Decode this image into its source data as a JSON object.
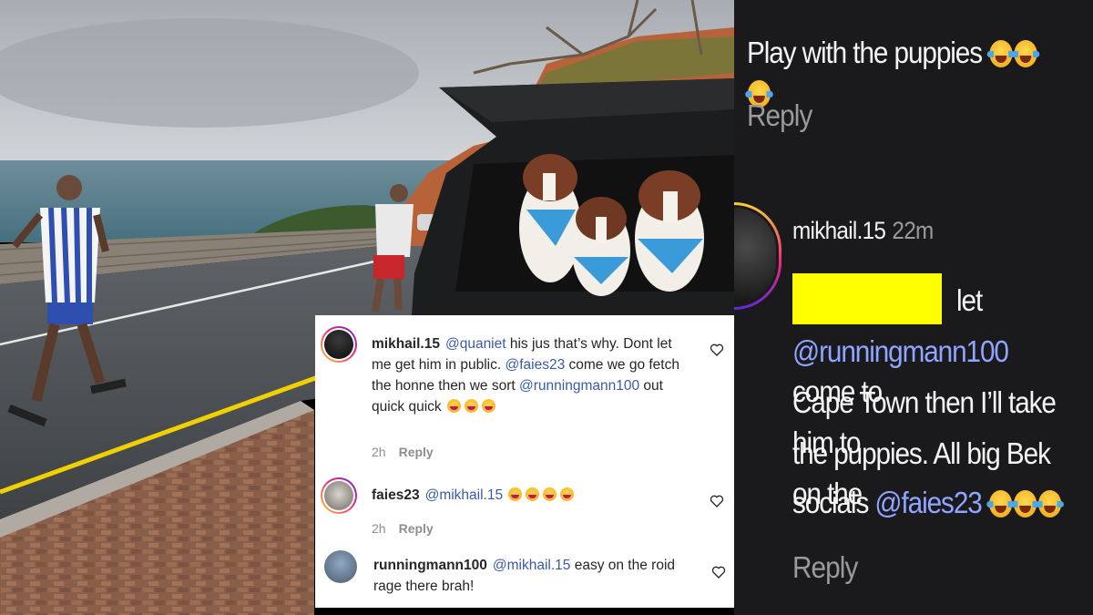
{
  "colors": {
    "mention_light": "#3a5ba8",
    "mention_dark": "#8fa5ff",
    "highlight_redaction": "#ffff00",
    "dark_panel_bg": "#1a1a1c"
  },
  "light_thread": {
    "comments": [
      {
        "username": "mikhail.15",
        "segments": [
          {
            "text": "@quaniet",
            "mention": true
          },
          {
            "text": " his jus that’s why. Dont let me get him in public. ",
            "mention": false
          },
          {
            "text": "@faies23",
            "mention": true
          },
          {
            "text": " come we go fetch the honne then we sort ",
            "mention": false
          },
          {
            "text": "@runningmann100",
            "mention": true
          },
          {
            "text": " out quick quick ",
            "mention": false
          }
        ],
        "emoji_count": 3,
        "time": "2h",
        "reply_label": "Reply",
        "avatar_ring": true
      },
      {
        "username": "faies23",
        "segments": [
          {
            "text": "@mikhail.15",
            "mention": true
          },
          {
            "text": " ",
            "mention": false
          }
        ],
        "emoji_count": 4,
        "time": "2h",
        "reply_label": "Reply",
        "avatar_ring": true
      },
      {
        "username": "runningmann100",
        "segments": [
          {
            "text": "@mikhail.15",
            "mention": true
          },
          {
            "text": " easy on the roid rage there brah!",
            "mention": false
          }
        ],
        "emoji_count": 0,
        "avatar_ring": false
      }
    ],
    "like_icon": "heart-outline-icon"
  },
  "dark_thread": {
    "top_comment_text": "Play with the puppies",
    "top_emoji_count": 3,
    "top_reply_label": "Reply",
    "comment": {
      "username": "mikhail.15",
      "time": "22m",
      "lines": [
        {
          "segments": [
            {
              "text": "let",
              "mention": false
            }
          ]
        },
        {
          "segments": [
            {
              "text": "@runningmann100",
              "mention": true
            },
            {
              "text": " come to",
              "mention": false
            }
          ]
        },
        {
          "segments": [
            {
              "text": "Cape Town then I’ll take him to",
              "mention": false
            }
          ]
        },
        {
          "segments": [
            {
              "text": "the puppies. All big Bek on the",
              "mention": false
            }
          ]
        },
        {
          "segments": [
            {
              "text": "socials ",
              "mention": false
            },
            {
              "text": "@faies23",
              "mention": true
            }
          ]
        }
      ],
      "emoji_count": 3,
      "reply_label": "Reply"
    }
  }
}
